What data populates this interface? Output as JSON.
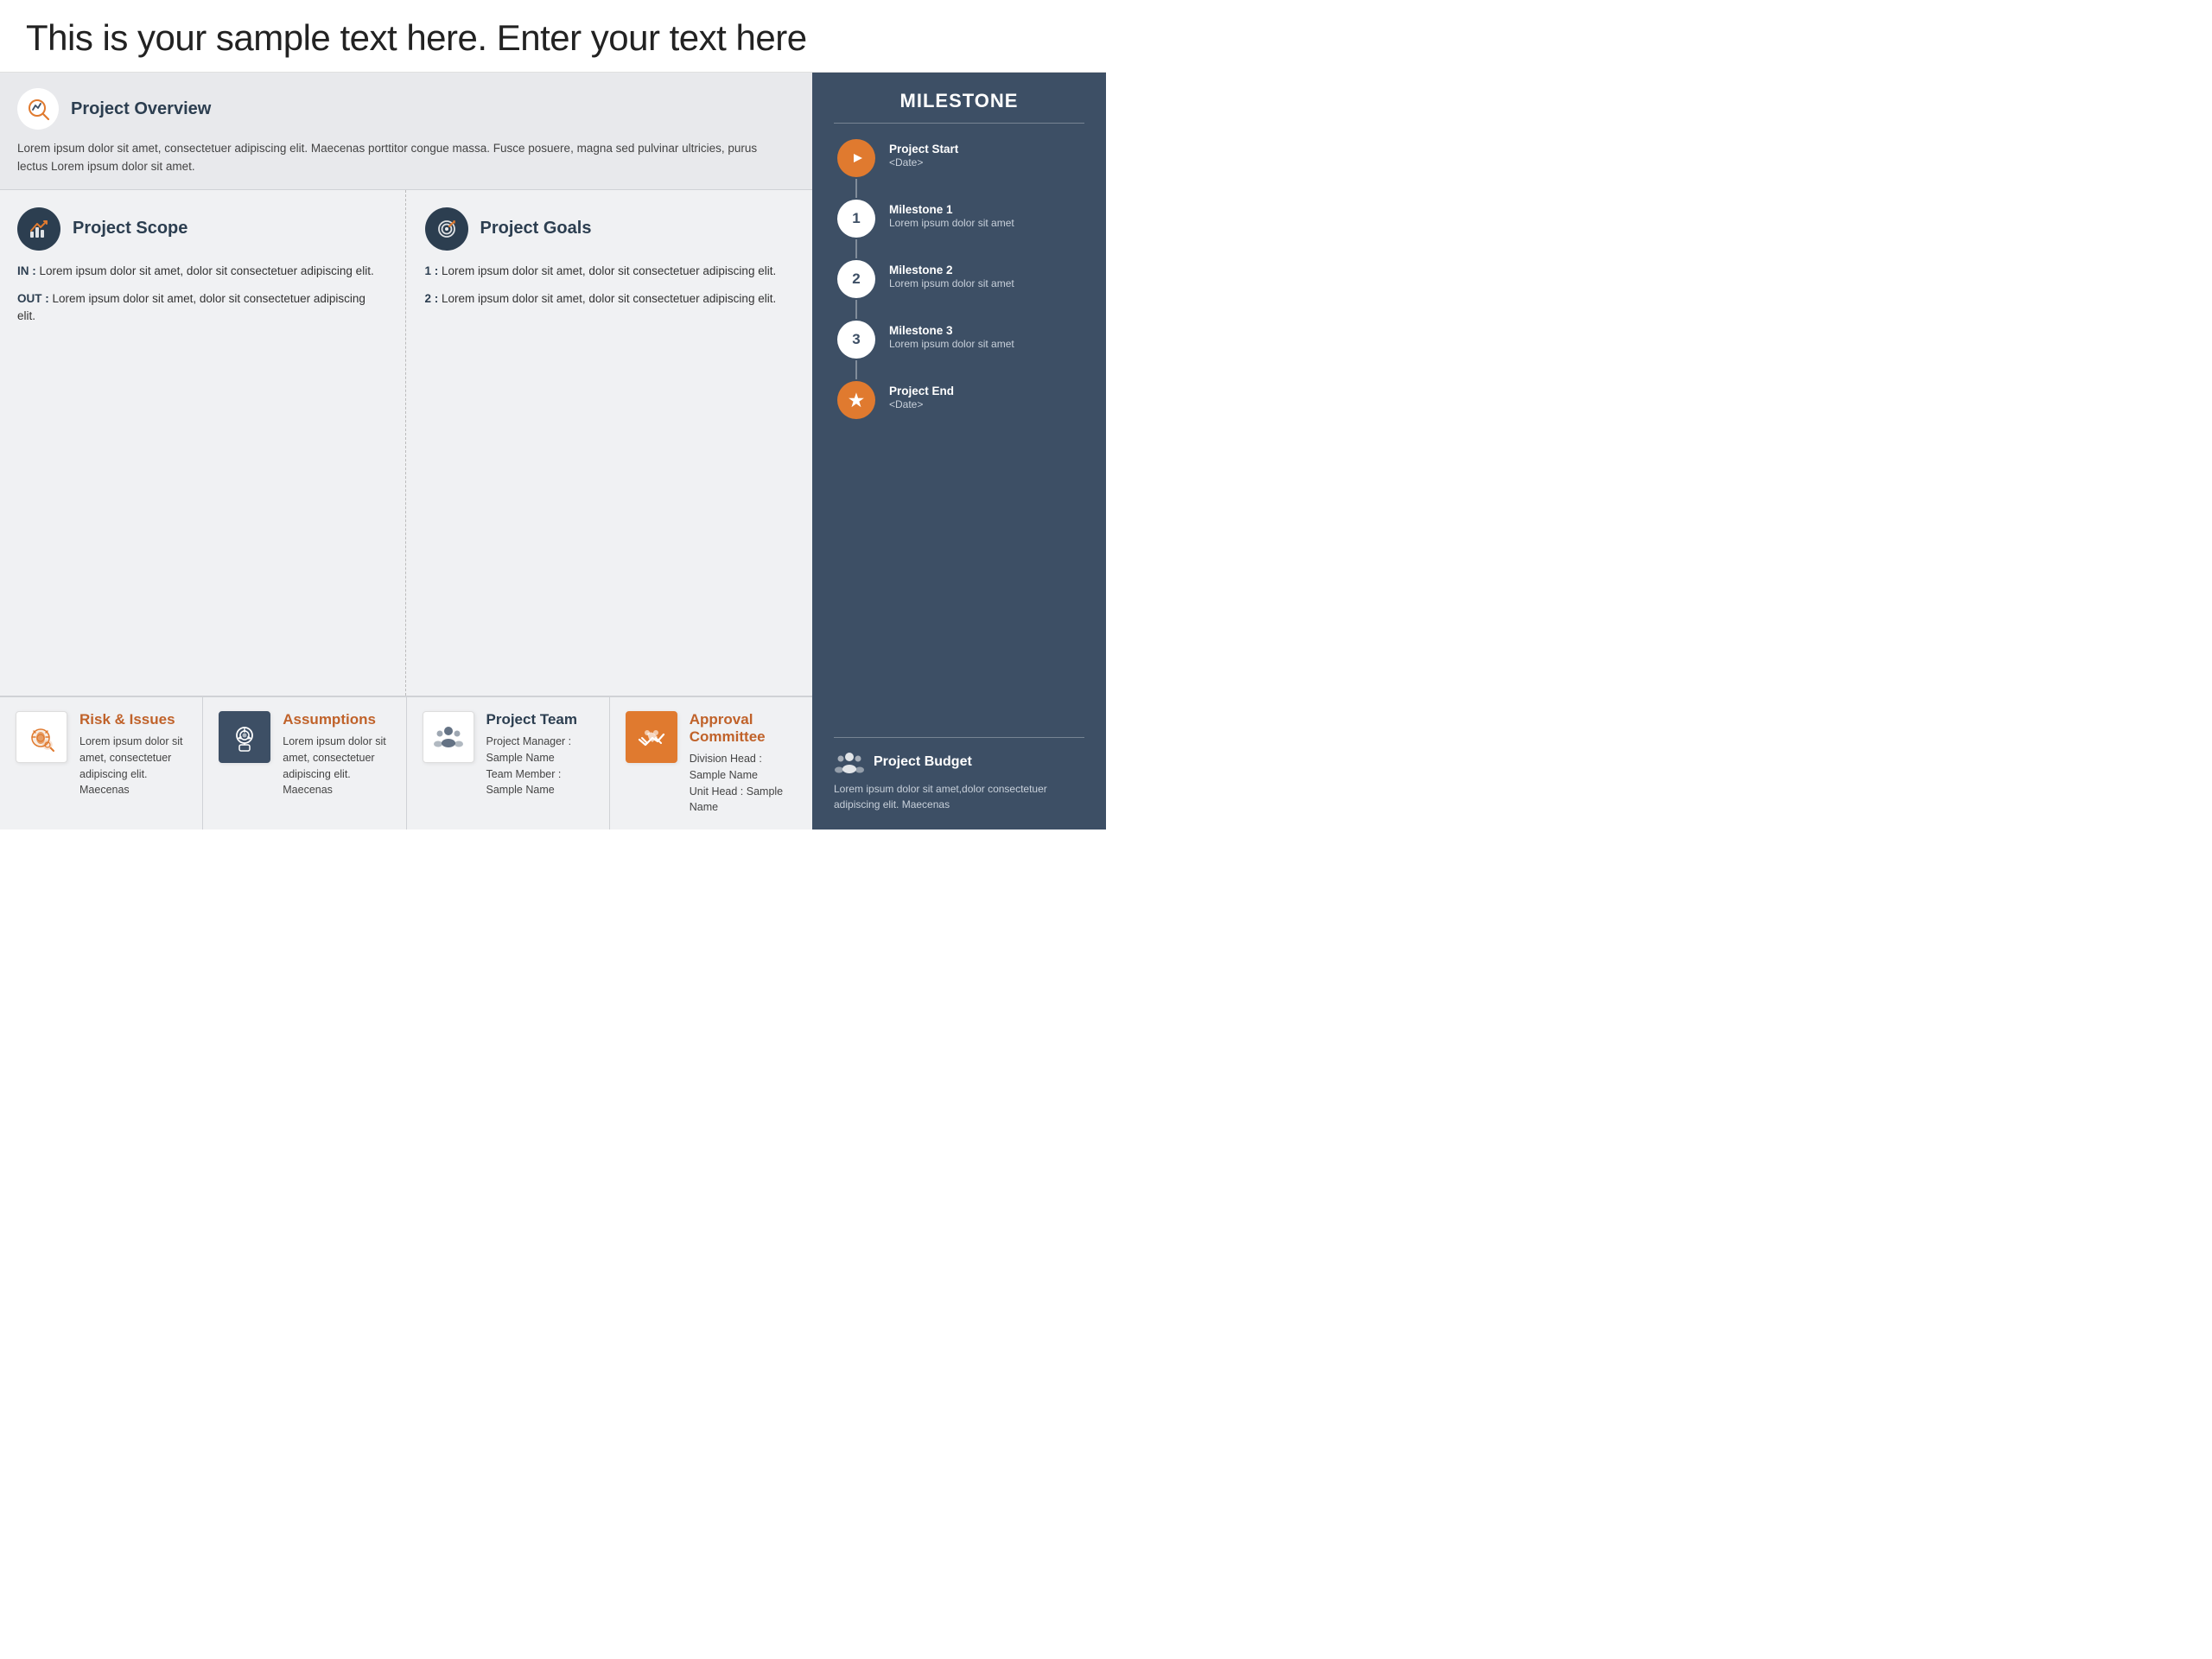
{
  "header": {
    "title": "This is your sample text here. Enter your text here"
  },
  "overview": {
    "title": "Project Overview",
    "text": "Lorem ipsum dolor sit amet, consectetuer adipiscing elit. Maecenas porttitor congue massa. Fusce posuere, magna sed pulvinar ultricies, purus lectus Lorem ipsum dolor sit amet."
  },
  "scope": {
    "title": "Project Scope",
    "in_label": "IN :",
    "in_text": "Lorem ipsum dolor sit amet, dolor sit consectetuer adipiscing elit.",
    "out_label": "OUT :",
    "out_text": "Lorem ipsum dolor sit amet, dolor sit consectetuer adipiscing elit."
  },
  "goals": {
    "title": "Project Goals",
    "item1_label": "1 :",
    "item1_text": "Lorem ipsum dolor sit amet, dolor sit consectetuer adipiscing elit.",
    "item2_label": "2 :",
    "item2_text": "Lorem ipsum dolor sit amet, dolor sit consectetuer adipiscing elit."
  },
  "risk": {
    "title": "Risk & Issues",
    "text": "Lorem ipsum dolor sit amet, consectetuer adipiscing elit. Maecenas"
  },
  "assumptions": {
    "title": "Assumptions",
    "text": "Lorem ipsum dolor sit amet, consectetuer adipiscing elit. Maecenas"
  },
  "team": {
    "title": "Project Team",
    "manager_label": "Project Manager : Sample Name",
    "member_label": "Team Member : Sample Name"
  },
  "committee": {
    "title": "Approval Committee",
    "division_label": "Division Head : Sample Name",
    "unit_label": "Unit Head : Sample Name"
  },
  "milestone": {
    "heading": "MILESTONE",
    "items": [
      {
        "id": "start",
        "type": "orange",
        "icon": "▶",
        "label": "Project Start",
        "sub": "<Date>"
      },
      {
        "id": "1",
        "type": "white",
        "icon": "1",
        "label": "Milestone 1",
        "sub": "Lorem ipsum dolor sit amet"
      },
      {
        "id": "2",
        "type": "white",
        "icon": "2",
        "label": "Milestone 2",
        "sub": "Lorem ipsum dolor sit amet"
      },
      {
        "id": "3",
        "type": "white",
        "icon": "3",
        "label": "Milestone 3",
        "sub": "Lorem ipsum dolor sit amet"
      },
      {
        "id": "end",
        "type": "orange",
        "icon": "★",
        "label": "Project End",
        "sub": "<Date>"
      }
    ]
  },
  "budget": {
    "title": "Project Budget",
    "text": "Lorem ipsum dolor sit amet,dolor consectetuer adipiscing elit. Maecenas"
  }
}
